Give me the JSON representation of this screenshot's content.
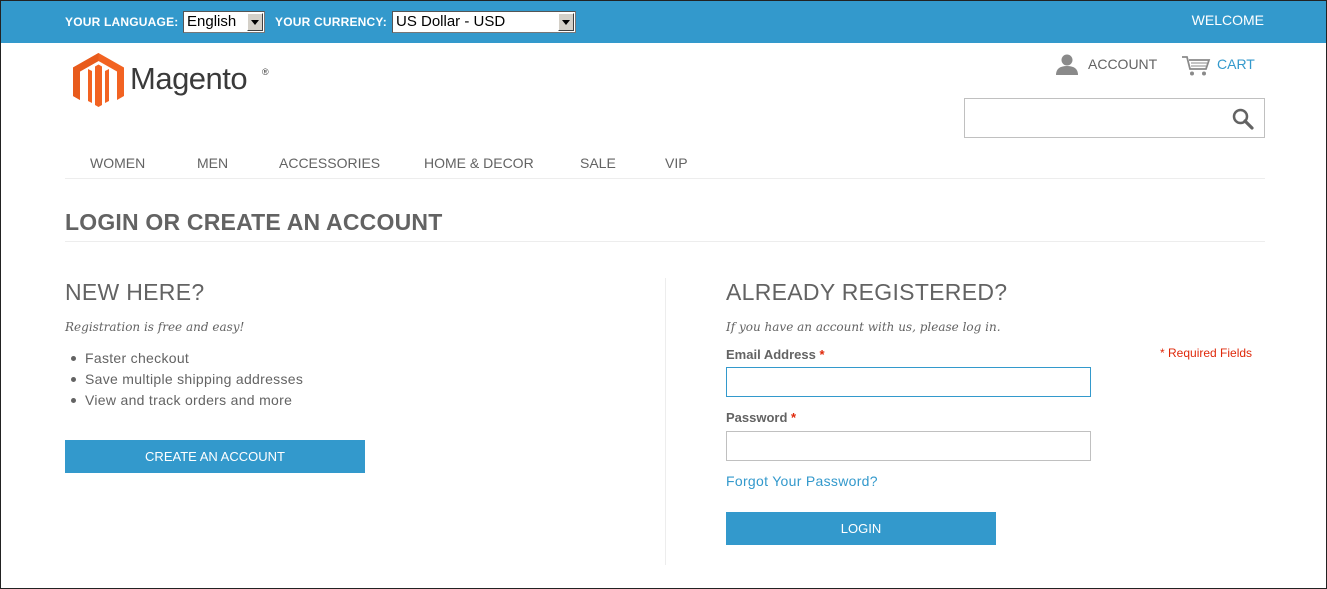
{
  "topbar": {
    "language_label": "YOUR LANGUAGE:",
    "language_value": "English",
    "currency_label": "YOUR CURRENCY:",
    "currency_value": "US Dollar - USD",
    "welcome": "WELCOME"
  },
  "header": {
    "logo_text": "Magento",
    "logo_mark": "®",
    "account_label": "ACCOUNT",
    "cart_label": "CART",
    "search_placeholder": ""
  },
  "nav": {
    "items": [
      "WOMEN",
      "MEN",
      "ACCESSORIES",
      "HOME & DECOR",
      "SALE",
      "VIP"
    ]
  },
  "page": {
    "title": "LOGIN OR CREATE AN ACCOUNT"
  },
  "new_customer": {
    "heading": "NEW HERE?",
    "subtitle": "Registration is free and easy!",
    "benefits": [
      "Faster checkout",
      "Save multiple shipping addresses",
      "View and track orders and more"
    ],
    "button": "CREATE AN ACCOUNT"
  },
  "login": {
    "heading": "ALREADY REGISTERED?",
    "subtitle": "If you have an account with us, please log in.",
    "required_note": "* Required Fields",
    "email_label": "Email Address",
    "password_label": "Password",
    "required_mark": "*",
    "email_value": "",
    "password_value": "",
    "forgot": "Forgot Your Password?",
    "button": "LOGIN"
  },
  "colors": {
    "accent": "#3399cc",
    "logo_orange": "#f26322",
    "required": "#df280a",
    "text": "#636363"
  },
  "icons": [
    "magento-logo-icon",
    "account-icon",
    "cart-icon",
    "search-icon",
    "dropdown-arrow-icon"
  ]
}
